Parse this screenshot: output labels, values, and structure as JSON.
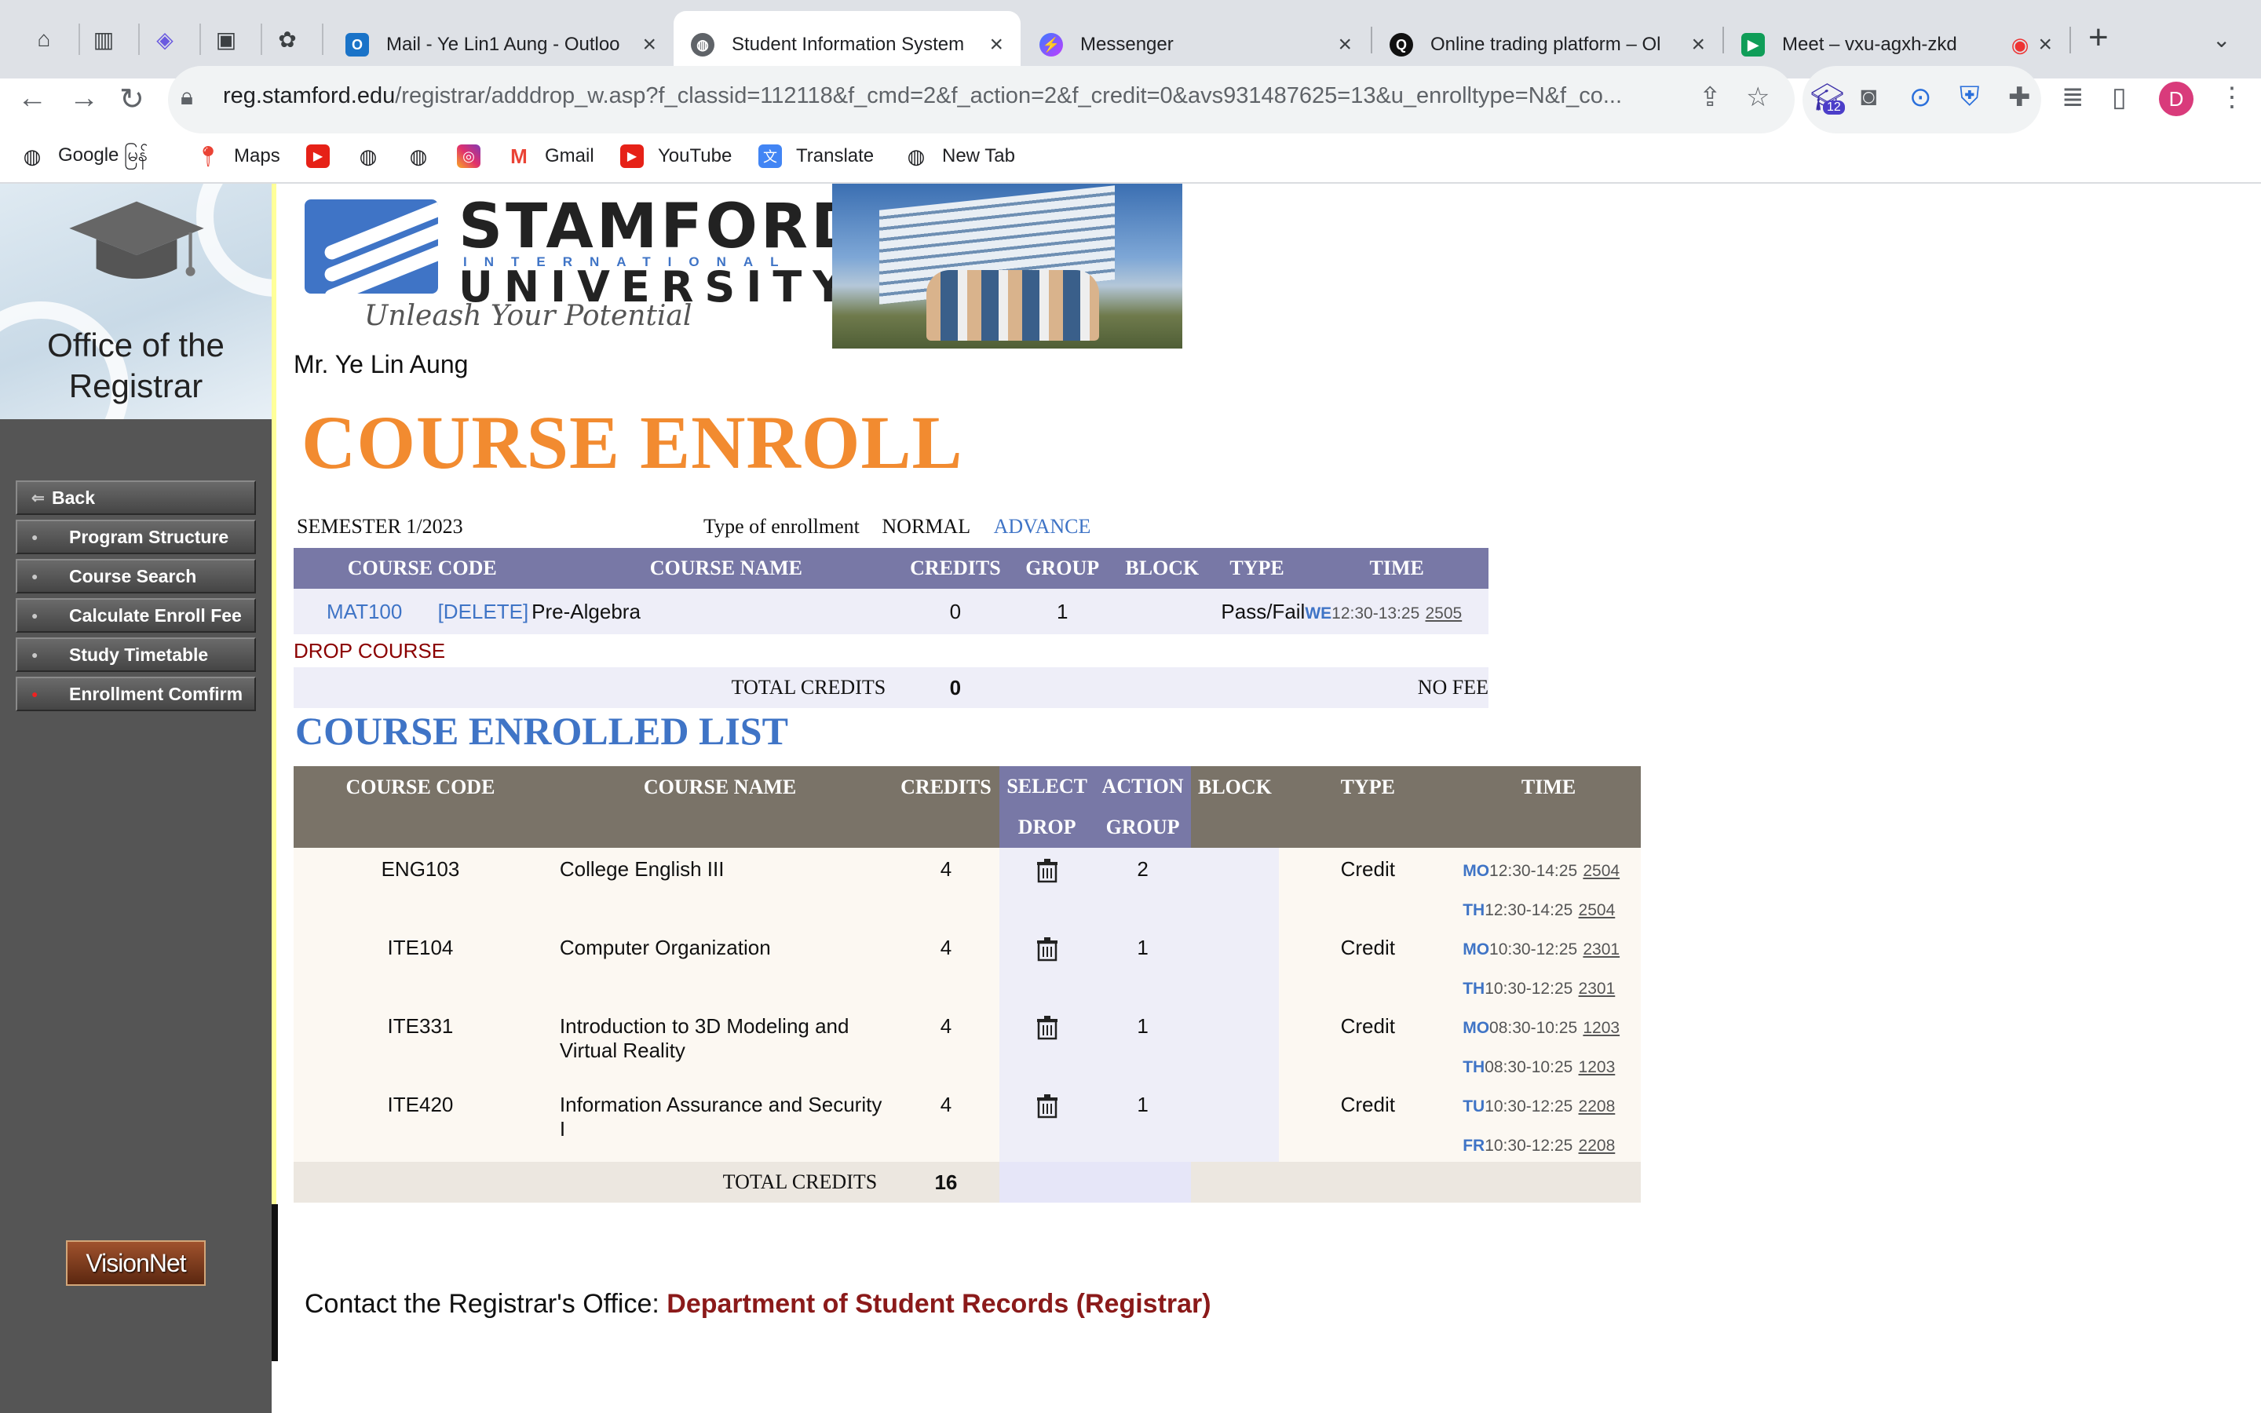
{
  "tabs": [
    {
      "title": "Mail - Ye Lin1 Aung - Outloo",
      "icon": "outlook-icon",
      "active": false
    },
    {
      "title": "Student Information System",
      "icon": "globe-icon",
      "active": true
    },
    {
      "title": "Messenger",
      "icon": "messenger-icon",
      "active": false
    },
    {
      "title": "Online trading platform – Ol",
      "icon": "trading-icon",
      "active": false
    },
    {
      "title": "Meet – vxu-agxh-zkd",
      "icon": "meet-icon",
      "active": false
    }
  ],
  "address": {
    "domain": "reg.stamford.edu",
    "path": "/registrar/adddrop_w.asp?f_classid=112118&f_cmd=2&f_action=2&f_credit=0&avs931487625=13&u_enrolltype=N&f_co..."
  },
  "extension_badge": "12",
  "profile_initial": "D",
  "bookmarks": [
    "Google မြန်",
    "Maps",
    "",
    "",
    "",
    "",
    "Gmail",
    "YouTube",
    "Translate",
    "New Tab"
  ],
  "sidebar": {
    "logo_text_1": "Office of the",
    "logo_text_2": "Registrar",
    "menu": [
      {
        "label": "Back",
        "icon": "back-arrow-icon"
      },
      {
        "label": "Program Structure",
        "icon": "bullet-icon"
      },
      {
        "label": "Course Search",
        "icon": "bullet-icon"
      },
      {
        "label": "Calculate Enroll Fee",
        "icon": "bullet-icon"
      },
      {
        "label": "Study Timetable",
        "icon": "bullet-icon"
      },
      {
        "label": "Enrollment Comfirm",
        "icon": "red-bullet-icon"
      }
    ],
    "footer_logo": "VisionNet"
  },
  "header": {
    "uni_line1": "STAMFORD",
    "uni_line2": "INTERNATIONAL",
    "uni_line3": "UNIVERSITY",
    "slogan": "Unleash Your Potential"
  },
  "student_name": "Mr. Ye Lin Aung",
  "page_title": "COURSE ENROLL",
  "semester": "SEMESTER 1/2023",
  "enrollment": {
    "label": "Type of enrollment",
    "normal": "NORMAL",
    "advance": "ADVANCE"
  },
  "enroll_table": {
    "headers": [
      "COURSE CODE",
      "COURSE NAME",
      "CREDITS",
      "GROUP",
      "BLOCK",
      "TYPE",
      "TIME"
    ],
    "row": {
      "code": "MAT100",
      "delete": "[DELETE]",
      "name": "Pre-Algebra",
      "credits": "0",
      "group": "1",
      "block": "",
      "type": "Pass/Fail",
      "day": "WE",
      "time": "12:30-13:25",
      "room": "2505"
    },
    "drop_course": "DROP COURSE",
    "total_label": "TOTAL CREDITS",
    "total": "0",
    "fee": "NO FEE"
  },
  "enrolled_title": "COURSE ENROLLED LIST",
  "enrolled_table": {
    "headers": {
      "code": "COURSE CODE",
      "name": "COURSE NAME",
      "credits": "CREDITS",
      "select": "SELECT",
      "action": "ACTION",
      "block": "BLOCK",
      "type": "TYPE",
      "time": "TIME",
      "drop": "DROP",
      "group": "GROUP"
    },
    "rows": [
      {
        "code": "ENG103",
        "name": "College English III",
        "credits": "4",
        "group": "2",
        "type": "Credit",
        "slots": [
          {
            "day": "MO",
            "time": "12:30-14:25",
            "room": "2504"
          },
          {
            "day": "TH",
            "time": "12:30-14:25",
            "room": "2504"
          }
        ]
      },
      {
        "code": "ITE104",
        "name": "Computer Organization",
        "credits": "4",
        "group": "1",
        "type": "Credit",
        "slots": [
          {
            "day": "MO",
            "time": "10:30-12:25",
            "room": "2301"
          },
          {
            "day": "TH",
            "time": "10:30-12:25",
            "room": "2301"
          }
        ]
      },
      {
        "code": "ITE331",
        "name": "Introduction to 3D Modeling and Virtual Reality",
        "credits": "4",
        "group": "1",
        "type": "Credit",
        "slots": [
          {
            "day": "MO",
            "time": "08:30-10:25",
            "room": "1203"
          },
          {
            "day": "TH",
            "time": "08:30-10:25",
            "room": "1203"
          }
        ]
      },
      {
        "code": "ITE420",
        "name": "Information Assurance and Security I",
        "credits": "4",
        "group": "1",
        "type": "Credit",
        "slots": [
          {
            "day": "TU",
            "time": "10:30-12:25",
            "room": "2208"
          },
          {
            "day": "FR",
            "time": "10:30-12:25",
            "room": "2208"
          }
        ]
      }
    ],
    "total_label": "TOTAL CREDITS",
    "total": "16"
  },
  "contact": {
    "label": "Contact the Registrar's Office:",
    "link": "Department of Student Records (Registrar)"
  }
}
